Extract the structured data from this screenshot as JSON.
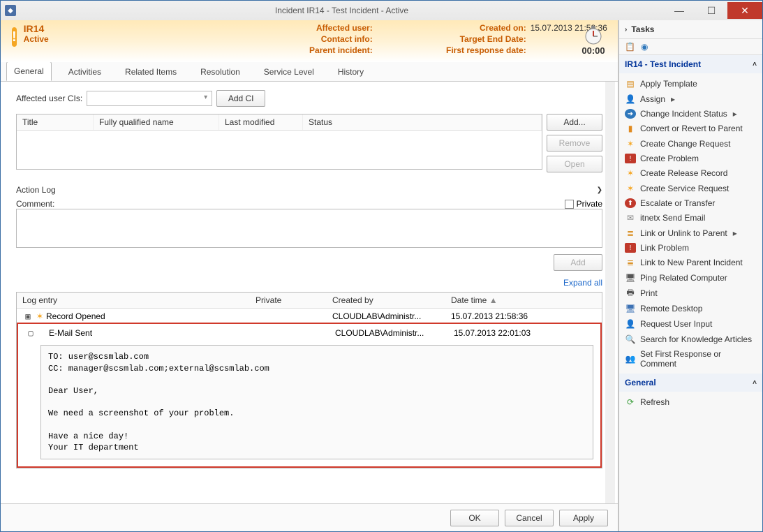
{
  "window": {
    "title": "Incident IR14 - Test Incident - Active"
  },
  "banner": {
    "id": "IR14",
    "status": "Active",
    "labels": {
      "affected_user": "Affected user:",
      "contact_info": "Contact info:",
      "parent_incident": "Parent incident:",
      "created_on": "Created on:",
      "target_end": "Target End Date:",
      "first_response": "First response date:"
    },
    "values": {
      "affected_user": "",
      "contact_info": "",
      "parent_incident": "",
      "created_on": "15.07.2013 21:58:36",
      "target_end": "",
      "first_response": ""
    },
    "timer": "00:00"
  },
  "tabs": [
    "General",
    "Activities",
    "Related Items",
    "Resolution",
    "Service Level",
    "History"
  ],
  "affected": {
    "label": "Affected user CIs:",
    "add_ci": "Add CI",
    "cols": [
      "Title",
      "Fully qualified name",
      "Last modified",
      "Status"
    ],
    "btns": {
      "add": "Add...",
      "remove": "Remove",
      "open": "Open"
    }
  },
  "actionlog": {
    "title": "Action Log",
    "comment_label": "Comment:",
    "private_label": "Private",
    "add": "Add",
    "expand_all": "Expand all",
    "cols": {
      "entry": "Log entry",
      "private": "Private",
      "created_by": "Created by",
      "datetime": "Date time"
    },
    "rows": [
      {
        "expanded": false,
        "icon": "✶",
        "entry": "Record Opened",
        "private": "",
        "created_by": "CLOUDLAB\\Administr...",
        "datetime": "15.07.2013 21:58:36"
      },
      {
        "expanded": true,
        "icon": "",
        "entry": "E-Mail Sent",
        "private": "",
        "created_by": "CLOUDLAB\\Administr...",
        "datetime": "15.07.2013 22:01:03"
      }
    ],
    "email_body": "TO: user@scsmlab.com\nCC: manager@scsmlab.com;external@scsmlab.com\n\nDear User,\n\nWe need a screenshot of your problem.\n\nHave a nice day!\nYour IT department"
  },
  "footer": {
    "ok": "OK",
    "cancel": "Cancel",
    "apply": "Apply"
  },
  "tasks": {
    "header": "Tasks",
    "group_title": "IR14 - Test Incident",
    "items": [
      "Apply Template",
      "Assign",
      "Change Incident Status",
      "Convert or Revert to Parent",
      "Create Change Request",
      "Create Problem",
      "Create Release Record",
      "Create Service Request",
      "Escalate or Transfer",
      "itnetx Send Email",
      "Link or Unlink to Parent",
      "Link Problem",
      "Link to New Parent Incident",
      "Ping Related Computer",
      "Print",
      "Remote Desktop",
      "Request User Input",
      "Search for Knowledge Articles",
      "Set First Response or Comment"
    ],
    "submenu": {
      "Assign": true,
      "Change Incident Status": true,
      "Link or Unlink to Parent": true
    },
    "general_header": "General",
    "general_items": [
      "Refresh"
    ]
  },
  "icons": {
    "tasks": {
      "Apply Template": {
        "glyph": "▤",
        "color": "#d88b1a"
      },
      "Assign": {
        "glyph": "👤",
        "color": "#5a8ec7"
      },
      "Change Incident Status": {
        "glyph": "➜",
        "color": "#2e77bb",
        "bg": "#2e77bb",
        "fg": "#fff",
        "round": true
      },
      "Convert or Revert to Parent": {
        "glyph": "▮",
        "color": "#e08a1f"
      },
      "Create Change Request": {
        "glyph": "✶",
        "color": "#f5a623"
      },
      "Create Problem": {
        "glyph": "!",
        "color": "#fff",
        "bg": "#c0392b"
      },
      "Create Release Record": {
        "glyph": "✶",
        "color": "#f5a623"
      },
      "Create Service Request": {
        "glyph": "✶",
        "color": "#f5a623"
      },
      "Escalate or Transfer": {
        "glyph": "⬆",
        "color": "#fff",
        "bg": "#c0392b",
        "round": true
      },
      "itnetx Send Email": {
        "glyph": "✉",
        "color": "#888"
      },
      "Link or Unlink to Parent": {
        "glyph": "≣",
        "color": "#d88b1a"
      },
      "Link Problem": {
        "glyph": "!",
        "color": "#fff",
        "bg": "#c0392b"
      },
      "Link to New Parent Incident": {
        "glyph": "≣",
        "color": "#d88b1a"
      },
      "Ping Related Computer": {
        "glyph": "🖥",
        "color": "#555"
      },
      "Print": {
        "glyph": "🖶",
        "color": "#555"
      },
      "Remote Desktop": {
        "glyph": "🖥",
        "color": "#3d72b4"
      },
      "Request User Input": {
        "glyph": "👤",
        "color": "#888"
      },
      "Search for Knowledge Articles": {
        "glyph": "🔍",
        "color": "#555"
      },
      "Set First Response or Comment": {
        "glyph": "👥",
        "color": "#888"
      },
      "Refresh": {
        "glyph": "⟳",
        "color": "#3a9d3a"
      }
    }
  }
}
